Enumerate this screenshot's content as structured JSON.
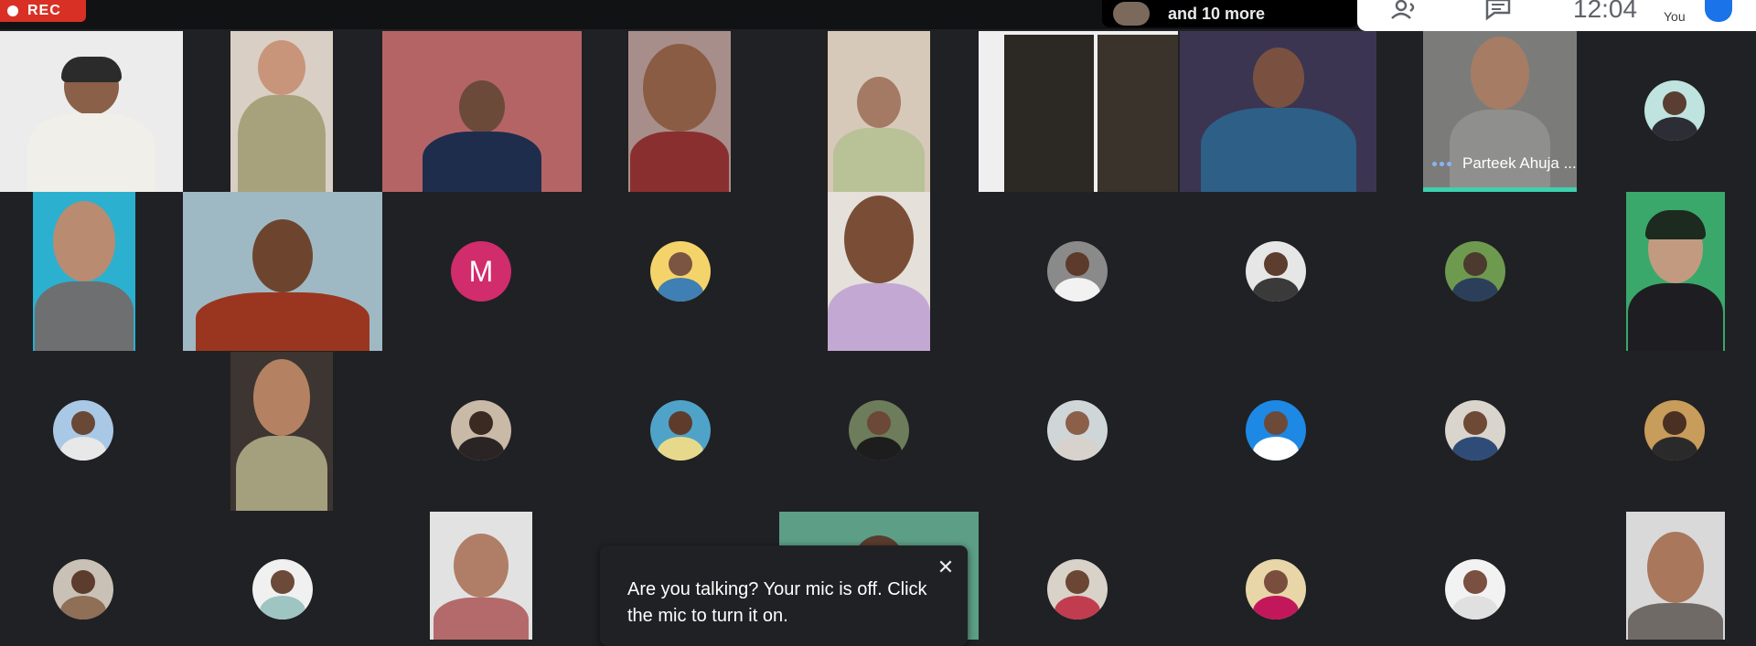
{
  "recording": {
    "label": "REC",
    "color": "#d93025"
  },
  "presenter_chip": {
    "text": "and 10 more"
  },
  "controls": {
    "time": "12:04",
    "self_label": "You",
    "icons": [
      "people-icon",
      "chat-icon"
    ]
  },
  "tiles": {
    "speaker_name": "Parteek Ahuja ...",
    "letter_avatar": "M"
  },
  "toast": {
    "message": "Are you talking? Your mic is off. Click the mic to turn it on.",
    "close_icon": "close-icon"
  },
  "colors": {
    "background": "#202124",
    "speaking_indicator": "#3fd0ae",
    "letter_avatar_bg": "#d12c6c"
  }
}
